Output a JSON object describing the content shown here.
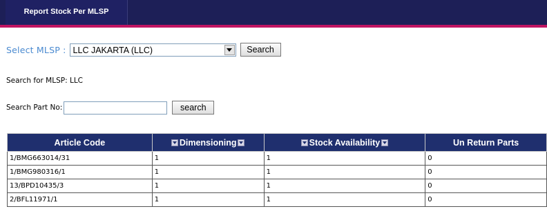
{
  "header": {
    "title": "Report Stock Per MLSP"
  },
  "mlsp": {
    "label": "Select MLSP :",
    "selected": "LLC JAKARTA (LLC)",
    "button": "Search"
  },
  "search_for": "Search for MLSP: LLC",
  "part": {
    "label": "Search Part No:",
    "value": "",
    "button": "search"
  },
  "table": {
    "columns": [
      "Article Code",
      "Dimensioning",
      "Stock Availability",
      "Un Return Parts"
    ],
    "rows": [
      [
        "1/BMG663014/31",
        "1",
        "1",
        "0"
      ],
      [
        "1/BMG980316/1",
        "1",
        "1",
        "0"
      ],
      [
        "13/BPD10435/3",
        "1",
        "1",
        "0"
      ],
      [
        "2/BFL11971/1",
        "1",
        "1",
        "0"
      ]
    ]
  },
  "colors": {
    "topbar": "#1d1f57",
    "accent_line": "#c01462",
    "table_header": "#1f2f6e",
    "label_blue": "#4a8ad0"
  }
}
